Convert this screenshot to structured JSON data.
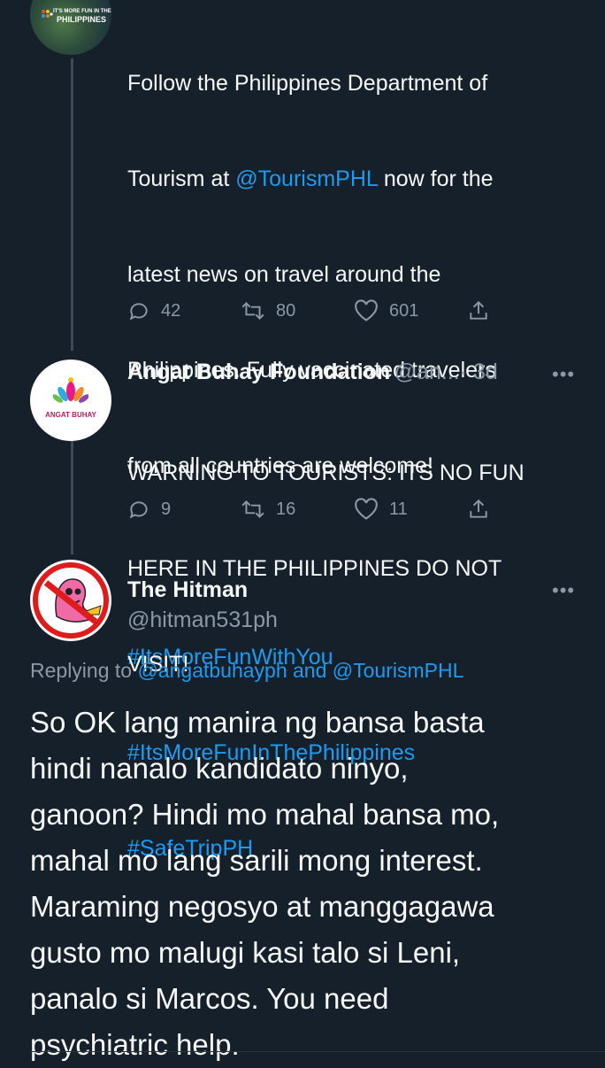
{
  "tweet1": {
    "avatar_text_top": "IT'S MORE FUN IN THE",
    "avatar_text_main": "PHILIPPINES",
    "text_lines": [
      "Follow the Philippines Department of",
      "Tourism at ",
      " now for the",
      "latest news on travel around the",
      "Philippines. Fully vaccinated travelers",
      "from all countries are welcome!"
    ],
    "mention": "@TourismPHL",
    "hashtags": [
      "#ItsMoreFunWithYou",
      "#ItsMoreFunInThePhilippines",
      "#SafeTripPH"
    ],
    "replies": "42",
    "retweets": "80",
    "likes": "601"
  },
  "tweet2": {
    "avatar_label": "ANGAT BUHAY",
    "name": "Angat Buhay Foundation",
    "handle": "@an...",
    "time": "· 3d",
    "text_lines": [
      "WARNING TO TOURISTS: ITS NO FUN",
      "HERE IN THE PHILIPPINES DO NOT",
      "VISIT!"
    ],
    "replies": "9",
    "retweets": "16",
    "likes": "11"
  },
  "tweet3": {
    "name": "The Hitman",
    "handle": "@hitman531ph",
    "replying_prefix": "Replying to ",
    "reply_to_1": "@angatbuhayph",
    "reply_and": " and ",
    "reply_to_2": "@TourismPHL",
    "text_lines": [
      "So OK lang manira ng bansa basta",
      "hindi nanalo kandidato ninyo,",
      "ganoon? Hindi mo mahal bansa mo,",
      "mahal mo lang sarili mong interest.",
      "Maraming negosyo at manggagawa",
      "gusto mo malugi kasi talo si Leni,",
      "panalo si Marcos. You need",
      "psychiatric help."
    ]
  },
  "more_label": "•••",
  "colors": {
    "background": "#15202b",
    "link": "#1d9bf0",
    "muted": "#8b98a5",
    "thread": "#3e4a56"
  }
}
